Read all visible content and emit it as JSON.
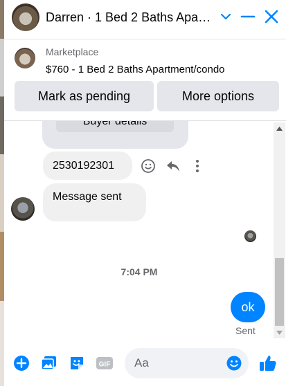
{
  "header": {
    "title": "Darren · 1 Bed 2 Baths Apa…",
    "icons": [
      "chevron-down-icon",
      "minimize-icon",
      "close-icon"
    ],
    "accent_color": "#0084ff"
  },
  "marketplace": {
    "label": "Marketplace",
    "item": "$760 - 1 Bed 2 Baths Apartment/condo",
    "buttons": {
      "pending": "Mark as pending",
      "more": "More options"
    }
  },
  "messages": {
    "buyer_details": "Buyer details",
    "phone": "2530192301",
    "message_sent": "Message sent",
    "timestamp": "7:04 PM",
    "outgoing": "ok",
    "status": "Sent"
  },
  "composer": {
    "placeholder": "Aa",
    "icons": [
      "plus-icon",
      "image-icon",
      "sticker-icon",
      "gif-icon",
      "emoji-icon",
      "thumbs-up-icon"
    ],
    "gif_label": "GIF"
  }
}
